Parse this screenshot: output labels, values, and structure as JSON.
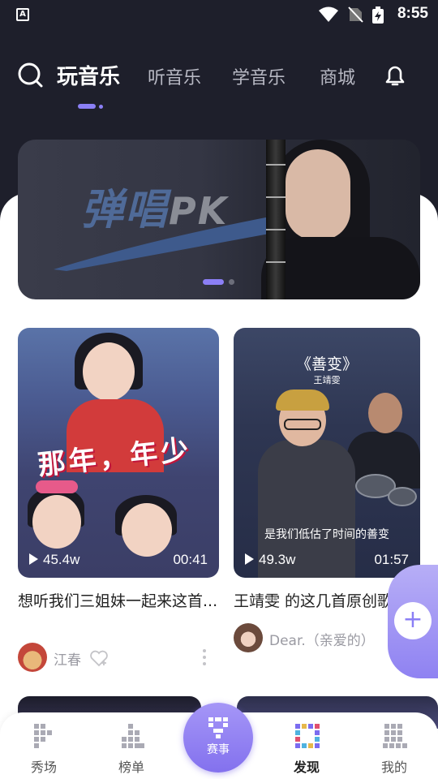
{
  "status_bar": {
    "time": "8:55",
    "app_icon_text": "A"
  },
  "header": {
    "tabs": [
      {
        "label": "玩音乐",
        "active": true
      },
      {
        "label": "听音乐",
        "active": false
      },
      {
        "label": "学音乐",
        "active": false
      },
      {
        "label": "商城",
        "active": false
      }
    ],
    "icons": [
      "search-icon",
      "bell-icon"
    ]
  },
  "banner": {
    "title": "弹唱",
    "title_suffix": "PK",
    "slide_count": 2,
    "active_slide": 1
  },
  "videos": [
    {
      "overlay_text": "那年，年少",
      "plays": "45.4w",
      "duration": "00:41",
      "title": "想听我们三姐妹一起来这首...",
      "author": "江春"
    },
    {
      "overlay_title": "《善变》",
      "overlay_artist": "王靖雯",
      "subtitle": "是我们低估了时间的善变",
      "plays": "49.3w",
      "duration": "01:57",
      "title": "王靖雯 的这几首原创歌",
      "author": "Dear.（亲爱的）"
    }
  ],
  "bottom_nav": {
    "items": [
      {
        "label": "秀场",
        "icon": "showroom-icon"
      },
      {
        "label": "榜单",
        "icon": "chart-icon"
      },
      {
        "label": "发现",
        "icon": "discover-icon",
        "active": true
      },
      {
        "label": "我的",
        "icon": "profile-icon"
      }
    ],
    "center": {
      "label": "赛事",
      "icon": "contest-icon"
    }
  },
  "colors": {
    "accent": "#8b7ff5",
    "header_bg": "#1e1f2b"
  }
}
